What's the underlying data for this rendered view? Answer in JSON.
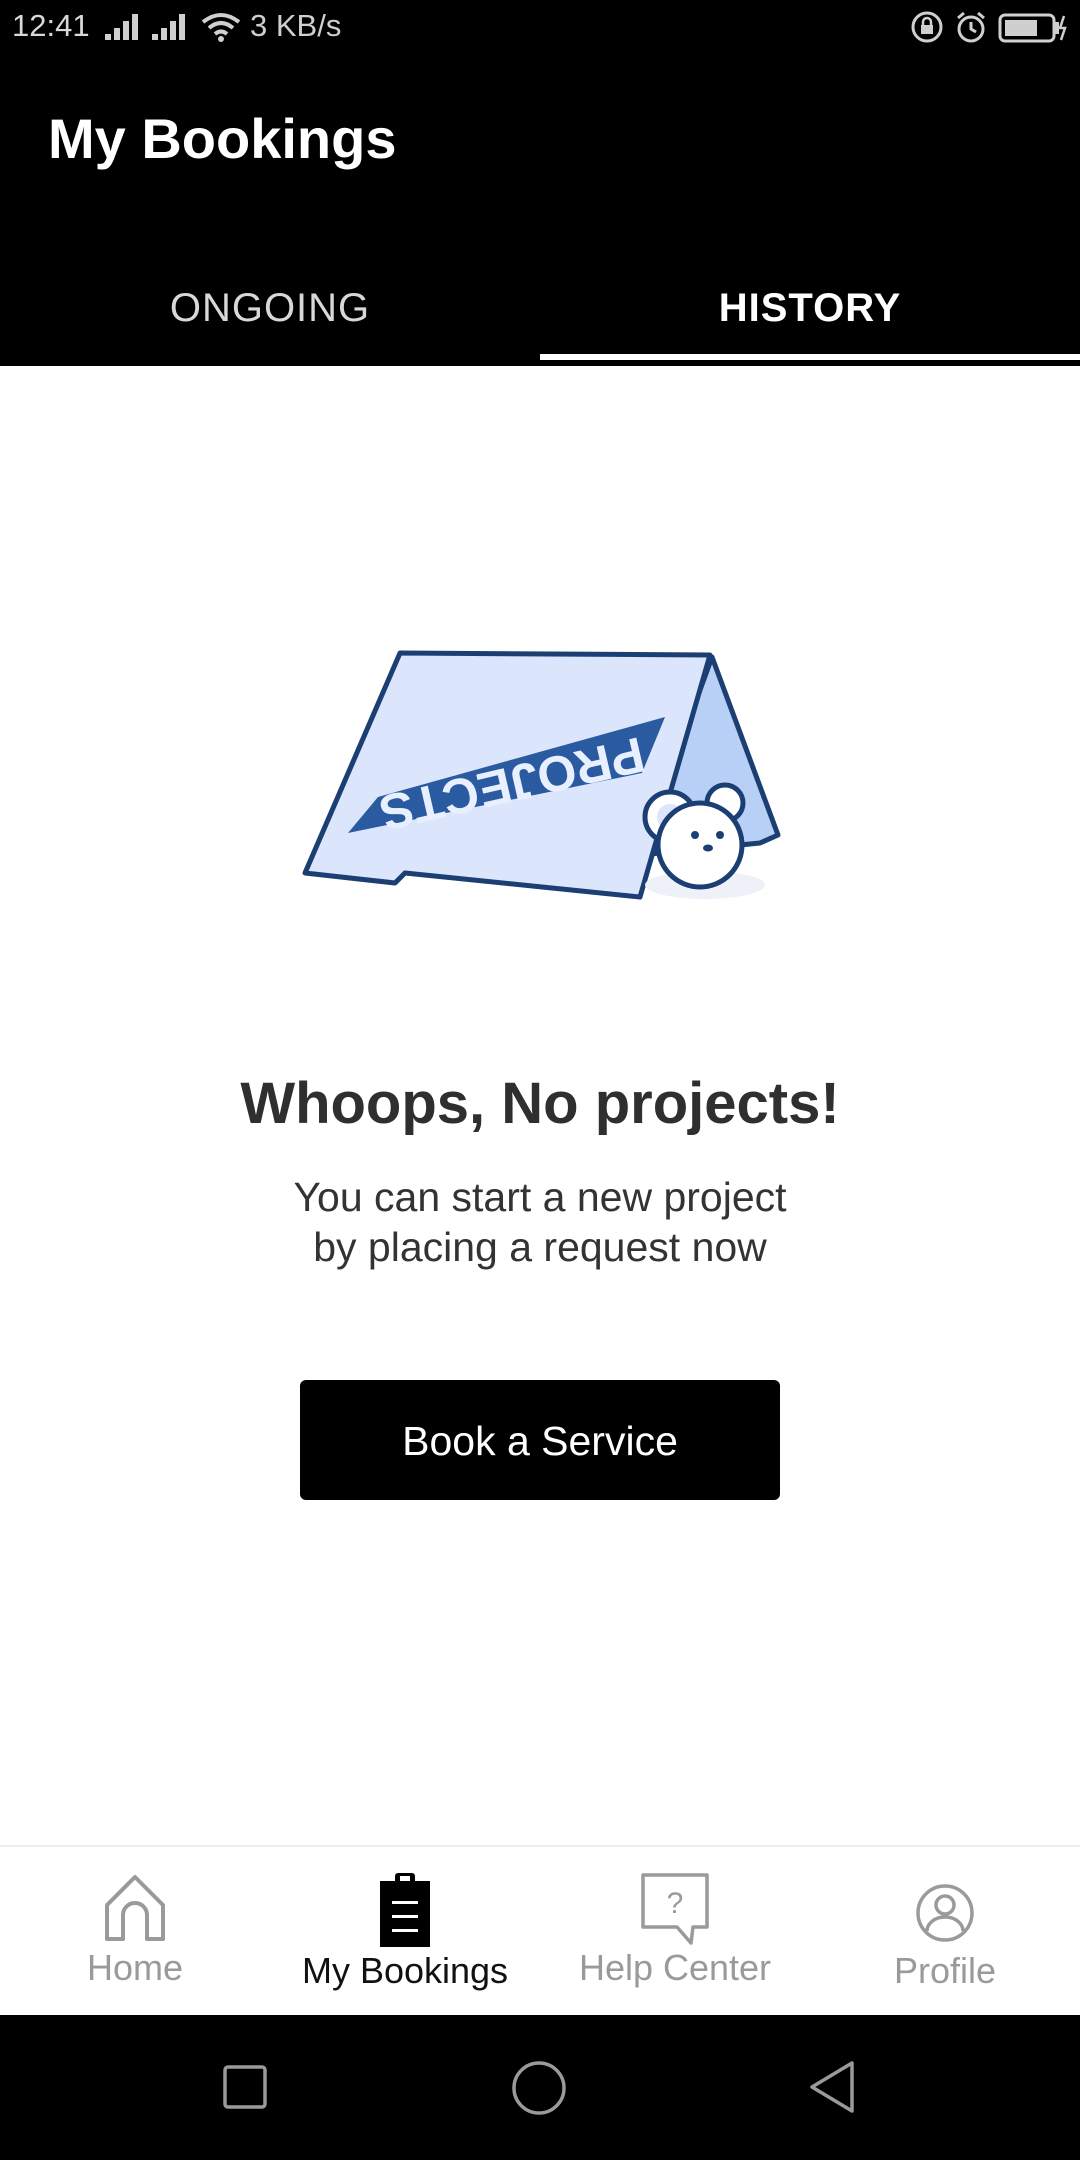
{
  "status_bar": {
    "time": "12:41",
    "network_speed": "3 KB/s"
  },
  "header": {
    "title": "My Bookings"
  },
  "tabs": [
    {
      "label": "ONGOING",
      "active": false
    },
    {
      "label": "HISTORY",
      "active": true
    }
  ],
  "illustration": {
    "sign_text": "PROJECTS"
  },
  "empty_state": {
    "title": "Whoops, No projects!",
    "line1": "You can start a new project",
    "line2": "by placing a request now",
    "button_label": "Book a Service"
  },
  "bottom_nav": [
    {
      "label": "Home",
      "icon": "home-icon",
      "active": false
    },
    {
      "label": "My Bookings",
      "icon": "clipboard-icon",
      "active": true
    },
    {
      "label": "Help Center",
      "icon": "help-icon",
      "active": false
    },
    {
      "label": "Profile",
      "icon": "profile-icon",
      "active": false
    }
  ],
  "colors": {
    "primary": "#000000",
    "background": "#ffffff",
    "inactive_nav": "#9a9a9a",
    "illustration_blue": "#1f4f8f",
    "illustration_light": "#d9e4fb"
  }
}
